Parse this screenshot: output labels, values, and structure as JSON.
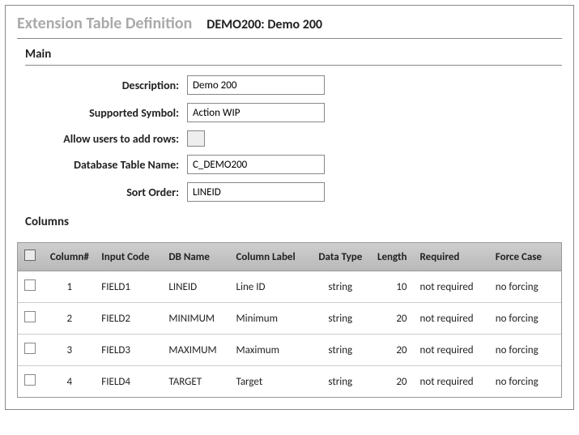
{
  "header": {
    "title": "Extension Table Definition",
    "subtitle": "DEMO200: Demo 200"
  },
  "main": {
    "section_label": "Main",
    "labels": {
      "description": "Description:",
      "supported_symbol": "Supported Symbol:",
      "allow_add_rows": "Allow users to add rows:",
      "db_table_name": "Database Table Name:",
      "sort_order": "Sort Order:"
    },
    "values": {
      "description": "Demo 200",
      "supported_symbol": "Action WIP",
      "db_table_name": "C_DEMO200",
      "sort_order": "LINEID"
    }
  },
  "columns": {
    "section_label": "Columns",
    "headers": {
      "column_num": "Column#",
      "input_code": "Input Code",
      "db_name": "DB Name",
      "column_label": "Column Label",
      "data_type": "Data Type",
      "length": "Length",
      "required": "Required",
      "force_case": "Force Case"
    },
    "rows": [
      {
        "num": "1",
        "input_code": "FIELD1",
        "db_name": "LINEID",
        "label": "Line ID",
        "data_type": "string",
        "length": "10",
        "required": "not required",
        "force_case": "no forcing"
      },
      {
        "num": "2",
        "input_code": "FIELD2",
        "db_name": "MINIMUM",
        "label": "Minimum",
        "data_type": "string",
        "length": "20",
        "required": "not required",
        "force_case": "no forcing"
      },
      {
        "num": "3",
        "input_code": "FIELD3",
        "db_name": "MAXIMUM",
        "label": "Maximum",
        "data_type": "string",
        "length": "20",
        "required": "not required",
        "force_case": "no forcing"
      },
      {
        "num": "4",
        "input_code": "FIELD4",
        "db_name": "TARGET",
        "label": "Target",
        "data_type": "string",
        "length": "20",
        "required": "not required",
        "force_case": "no forcing"
      }
    ]
  }
}
